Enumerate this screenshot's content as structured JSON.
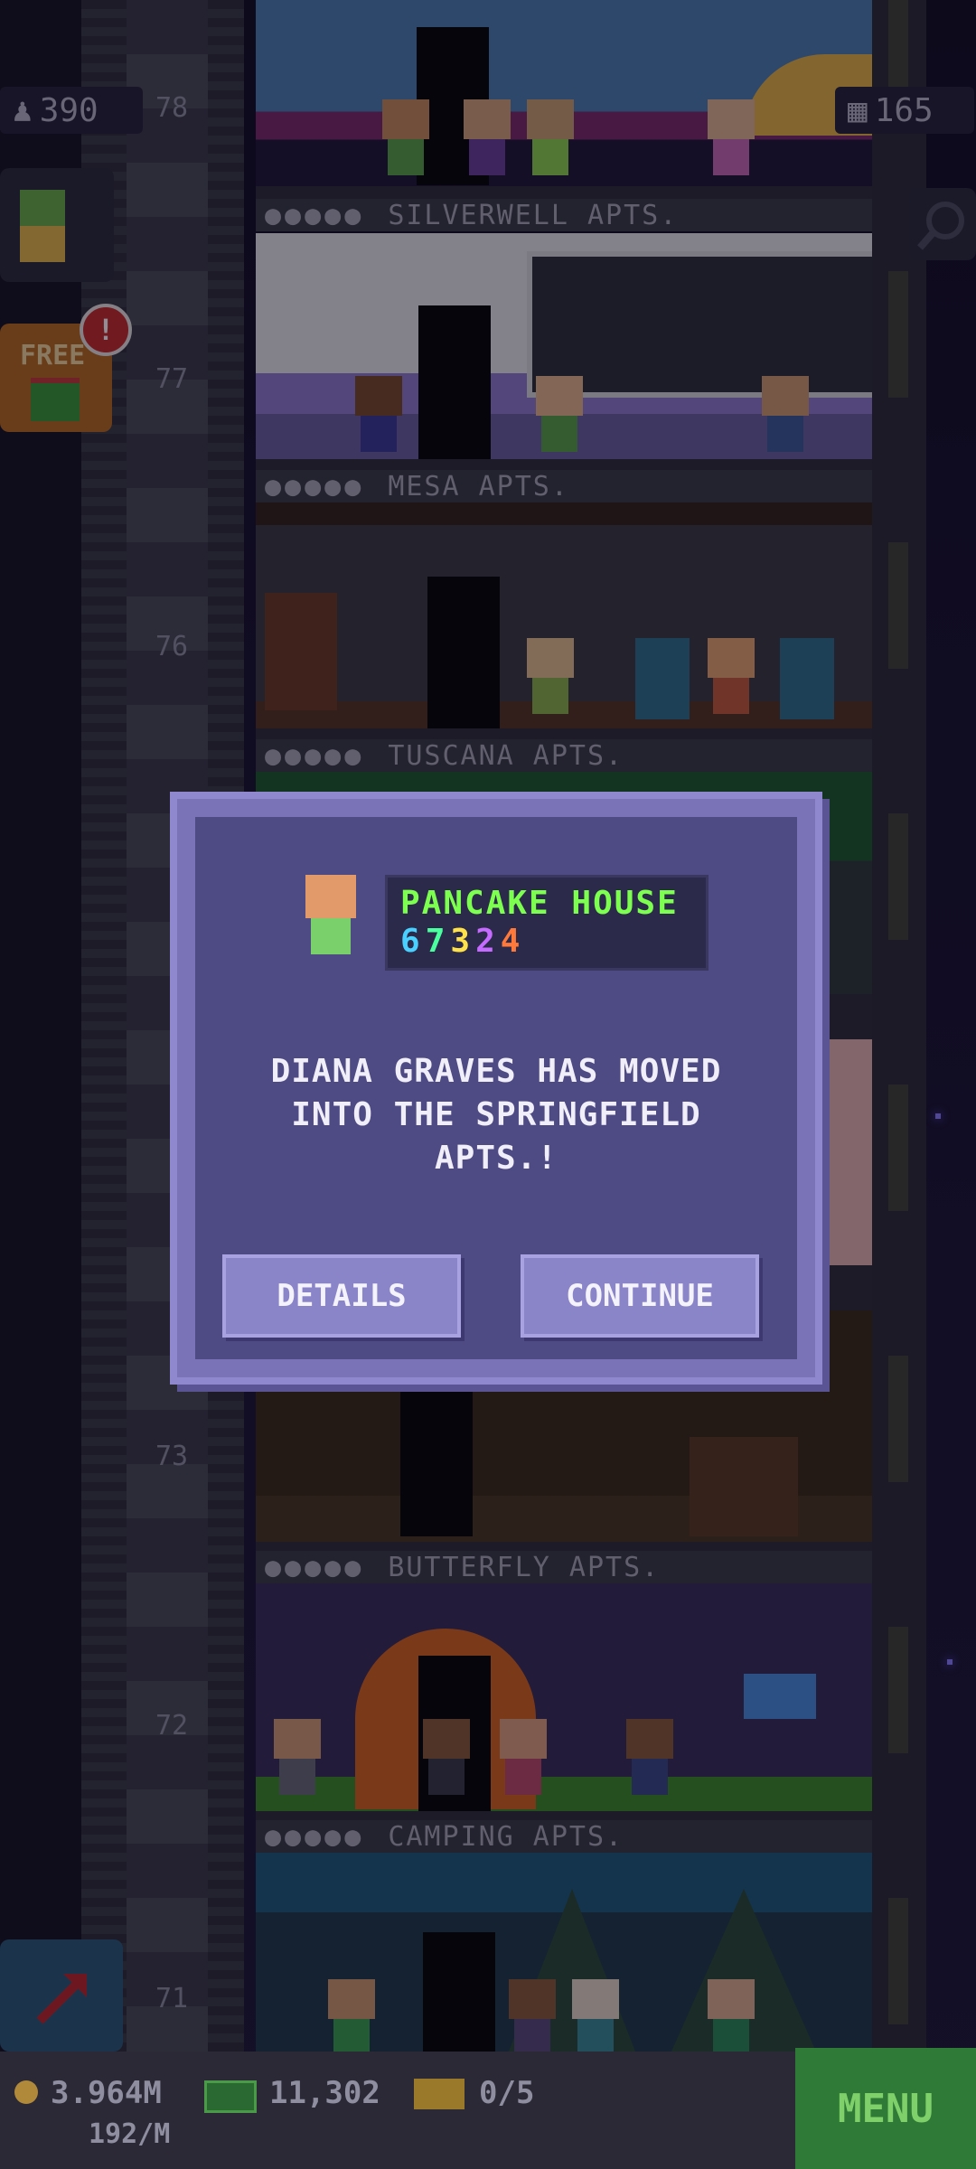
{
  "top_left_stat": {
    "icon": "population-icon",
    "value": "390"
  },
  "top_right_stat": {
    "icon": "building-icon",
    "value": "165"
  },
  "side": {
    "free_label": "FREE",
    "free_badge": "!"
  },
  "floors": [
    {
      "number": "78",
      "label": "SILVERWELL APTS."
    },
    {
      "number": "77",
      "label": "MESA APTS."
    },
    {
      "number": "76",
      "label": "TUSCANA APTS."
    },
    {
      "number": "73",
      "label": "BUTTERFLY APTS."
    },
    {
      "number": "72",
      "label": "CAMPING APTS."
    },
    {
      "number": "71",
      "label": ""
    }
  ],
  "dialog": {
    "business_name": "PANCAKE HOUSE",
    "bitizen_digits": [
      "6",
      "7",
      "3",
      "2",
      "4"
    ],
    "digit_colors": [
      "#4ad0ff",
      "#4aff9e",
      "#ffe14a",
      "#c66bff",
      "#ff7a3a"
    ],
    "message": "DIANA GRAVES HAS MOVED INTO THE SPRINGFIELD APTS.!",
    "details_label": "DETAILS",
    "continue_label": "CONTINUE"
  },
  "bottom": {
    "coins": "3.964M",
    "coin_rate": "192/M",
    "bux": "11,302",
    "tickets": "0/5",
    "menu_label": "MENU"
  },
  "colors": {
    "accent_green": "#7cff4e",
    "dialog_purple": "#4e4a84"
  }
}
